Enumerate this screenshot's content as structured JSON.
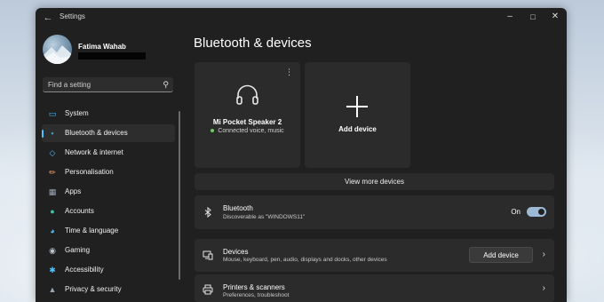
{
  "window": {
    "title": "Settings"
  },
  "profile": {
    "name": "Fatima Wahab"
  },
  "search": {
    "placeholder": "Find a setting"
  },
  "nav": {
    "items": [
      {
        "label": "System",
        "icon": "monitor-icon",
        "color": "#4cc2ff"
      },
      {
        "label": "Bluetooth & devices",
        "icon": "bluetooth-icon",
        "color": "#4cc2ff",
        "active": true
      },
      {
        "label": "Network & internet",
        "icon": "wifi-icon",
        "color": "#4cc2ff"
      },
      {
        "label": "Personalisation",
        "icon": "brush-icon",
        "color": "#f7a26b"
      },
      {
        "label": "Apps",
        "icon": "apps-icon",
        "color": "#9aa7b6"
      },
      {
        "label": "Accounts",
        "icon": "person-icon",
        "color": "#38c6a3"
      },
      {
        "label": "Time & language",
        "icon": "globe-clock-icon",
        "color": "#4cc2ff"
      },
      {
        "label": "Gaming",
        "icon": "gamepad-icon",
        "color": "#b9c4cf"
      },
      {
        "label": "Accessibility",
        "icon": "accessibility-icon",
        "color": "#4cc2ff"
      },
      {
        "label": "Privacy & security",
        "icon": "shield-icon",
        "color": "#9aa7b6"
      }
    ]
  },
  "main": {
    "title": "Bluetooth & devices",
    "device_card": {
      "name": "Mi Pocket Speaker 2",
      "status": "Connected voice, music",
      "icon": "headphones-icon"
    },
    "add_card": {
      "label": "Add device"
    },
    "view_more": "View more devices",
    "bluetooth": {
      "title": "Bluetooth",
      "subtitle": "Discoverable as \"WINDOWS11\"",
      "toggle_label": "On",
      "toggle_on": true
    },
    "devices": {
      "title": "Devices",
      "subtitle": "Mouse, keyboard, pen, audio, displays and docks, other devices",
      "button": "Add device"
    },
    "printers": {
      "title": "Printers & scanners",
      "subtitle": "Preferences, troubleshoot"
    }
  },
  "colors": {
    "accent": "#4cc2ff",
    "window_bg": "#202020",
    "card_bg": "#2b2b2b",
    "toggle_on": "#9cbad5"
  }
}
